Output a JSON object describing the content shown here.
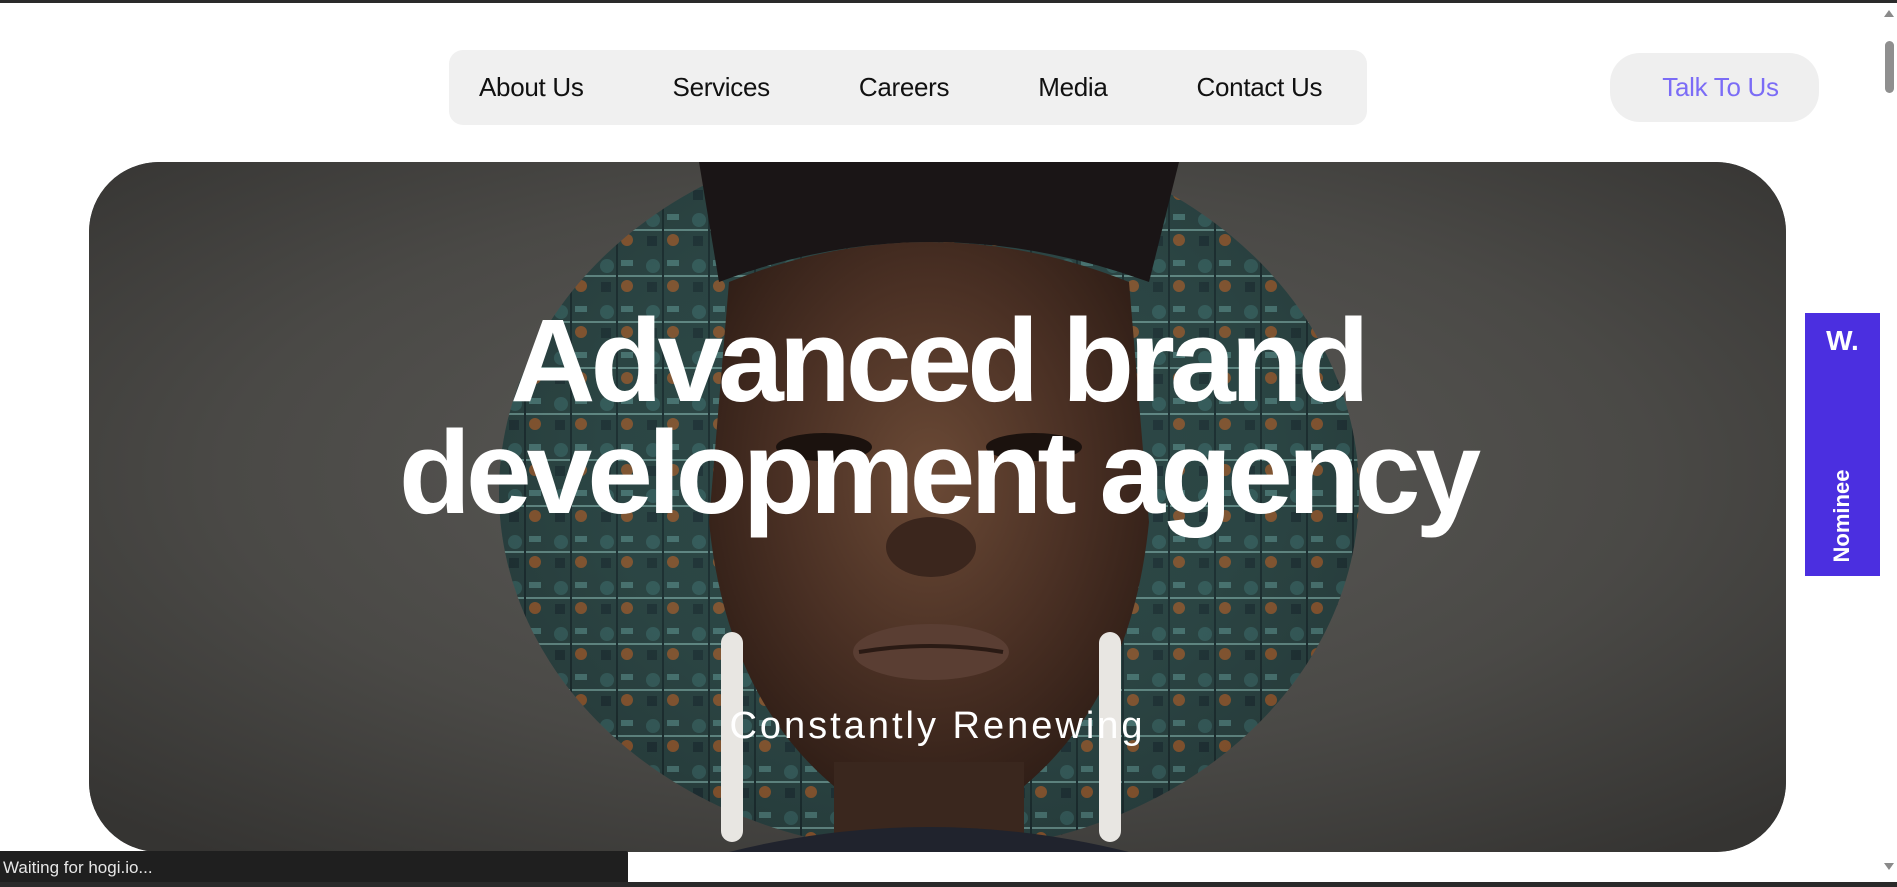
{
  "nav": {
    "items": [
      "About Us",
      "Services",
      "Careers",
      "Media",
      "Contact Us"
    ]
  },
  "cta": {
    "label": "Talk To Us"
  },
  "hero": {
    "title_line1": "Advanced brand",
    "title_line2": "development agency",
    "subtitle": "Constantly Renewing"
  },
  "award": {
    "logo": "W.",
    "label": "Nominee",
    "color": "#4b2fe0"
  },
  "status_bar": {
    "text": "Waiting for hogi.io..."
  },
  "colors": {
    "accent": "#7b6cf6",
    "nav_bg": "#f0f0f0"
  }
}
